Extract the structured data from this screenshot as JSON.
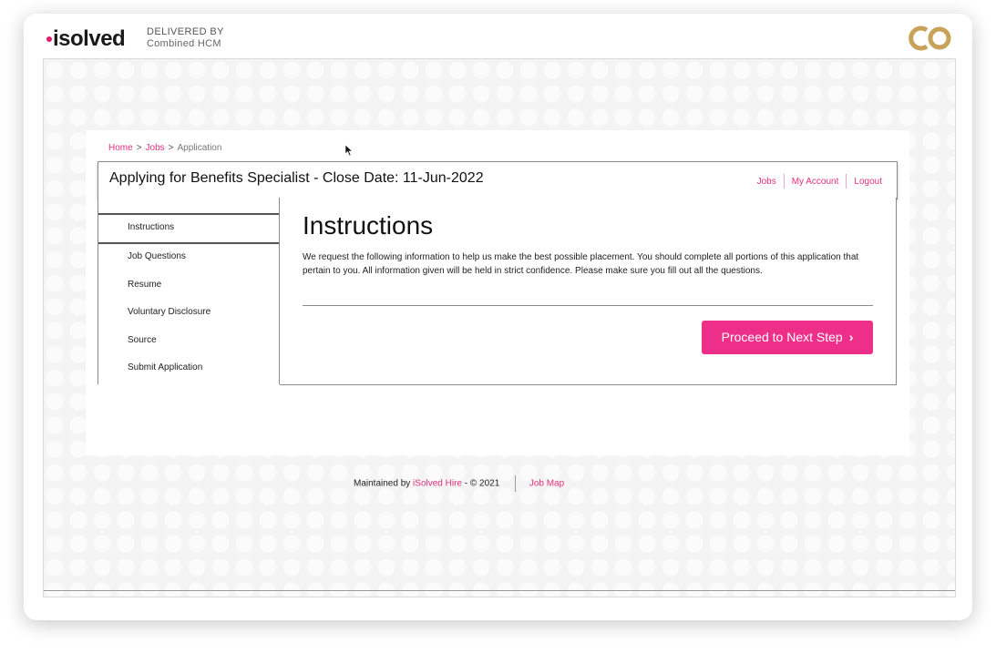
{
  "brand": {
    "logo_text": "isolved",
    "delivered_by_line1": "DELIVERED BY",
    "delivered_by_line2": "Combined HCM",
    "partner_logo": "CO"
  },
  "breadcrumb": {
    "home": "Home",
    "jobs": "Jobs",
    "current": "Application",
    "separator": ">"
  },
  "header": {
    "title": "Applying for Benefits Specialist - Close Date: 11-Jun-2022",
    "nav": [
      "Jobs",
      "My Account",
      "Logout"
    ]
  },
  "sidebar": {
    "items": [
      "Instructions",
      "Job Questions",
      "Resume",
      "Voluntary Disclosure",
      "Source",
      "Submit Application"
    ],
    "active": "Instructions"
  },
  "main": {
    "heading": "Instructions",
    "description": "We request the following information to help us make the best possible placement. You should complete all portions of this application that pertain to you. All information given will be held in strict confidence. Please make sure you fill out all the questions.",
    "proceed_label": "Proceed to Next Step",
    "proceed_icon": "chevron-right-icon"
  },
  "footer": {
    "maintained_by": "Maintained by",
    "company_link": "iSolved Hire",
    "copyright": "- © 2021",
    "job_map": "Job Map"
  },
  "colors": {
    "accent": "#ee2f8a",
    "link": "#e0317e",
    "partner_gold": "#c9a25a"
  }
}
